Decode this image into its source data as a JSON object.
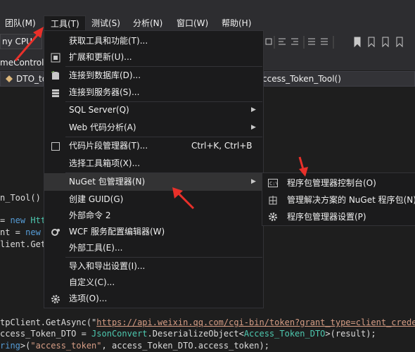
{
  "menubar": {
    "items": [
      {
        "label": "团队(M)"
      },
      {
        "label": "工具(T)"
      },
      {
        "label": "测试(S)"
      },
      {
        "label": "分析(N)"
      },
      {
        "label": "窗口(W)"
      },
      {
        "label": "帮助(H)"
      }
    ]
  },
  "toolbar": {
    "platform_value": "ny CPU"
  },
  "nav": {
    "left_tab": "meControll",
    "member_box": "DTO_to",
    "method_box": "ccess_Token_Tool()"
  },
  "editor": {
    "lines": {
      "l1": "n_Tool()",
      "l2a": "= ",
      "l2b": "new",
      "l2c": " Htt",
      "l3a": "nt = ",
      "l3b": "new",
      "l3c": " H",
      "l4": "lient.Get",
      "l5a": "tpClient.GetAsync(\"",
      "l5b": "https://api.weixin.qq.com/cgi-bin/token?grant_type=client_credent",
      "l6a": "ccess_Token_DTO = ",
      "l6b": "JsonConvert",
      "l6c": ".DeserializeObject<",
      "l6d": "Access_Token_DTO",
      "l6e": ">(result);",
      "l7a": "ring",
      "l7b": ">(",
      "l7c": "\"access_token\"",
      "l7d": ", access_Token_DTO.access_token);"
    }
  },
  "tools_menu": {
    "items": [
      {
        "label": "获取工具和功能(T)..."
      },
      {
        "label": "扩展和更新(U)..."
      },
      {
        "label": "连接到数据库(D)..."
      },
      {
        "label": "连接到服务器(S)..."
      },
      {
        "label": "SQL Server(Q)"
      },
      {
        "label": "Web 代码分析(A)"
      },
      {
        "label": "代码片段管理器(T)...",
        "shortcut": "Ctrl+K, Ctrl+B"
      },
      {
        "label": "选择工具箱项(X)..."
      },
      {
        "label": "NuGet 包管理器(N)"
      },
      {
        "label": "创建 GUID(G)"
      },
      {
        "label": "外部命令 2"
      },
      {
        "label": "WCF 服务配置编辑器(W)"
      },
      {
        "label": "外部工具(E)..."
      },
      {
        "label": "导入和导出设置(I)..."
      },
      {
        "label": "自定义(C)..."
      },
      {
        "label": "选项(O)..."
      }
    ],
    "submenu_arrow": "▶"
  },
  "nuget_submenu": {
    "items": [
      {
        "label": "程序包管理器控制台(O)",
        "icon": "console-icon"
      },
      {
        "label": "管理解决方案的 NuGet 程序包(N)...",
        "icon": "package-icon"
      },
      {
        "label": "程序包管理器设置(P)",
        "icon": "gear-icon"
      }
    ]
  },
  "colors": {
    "annotation_arrow": "#e8302a",
    "menu_bg": "#1b1b1c",
    "highlight": "#333334"
  }
}
